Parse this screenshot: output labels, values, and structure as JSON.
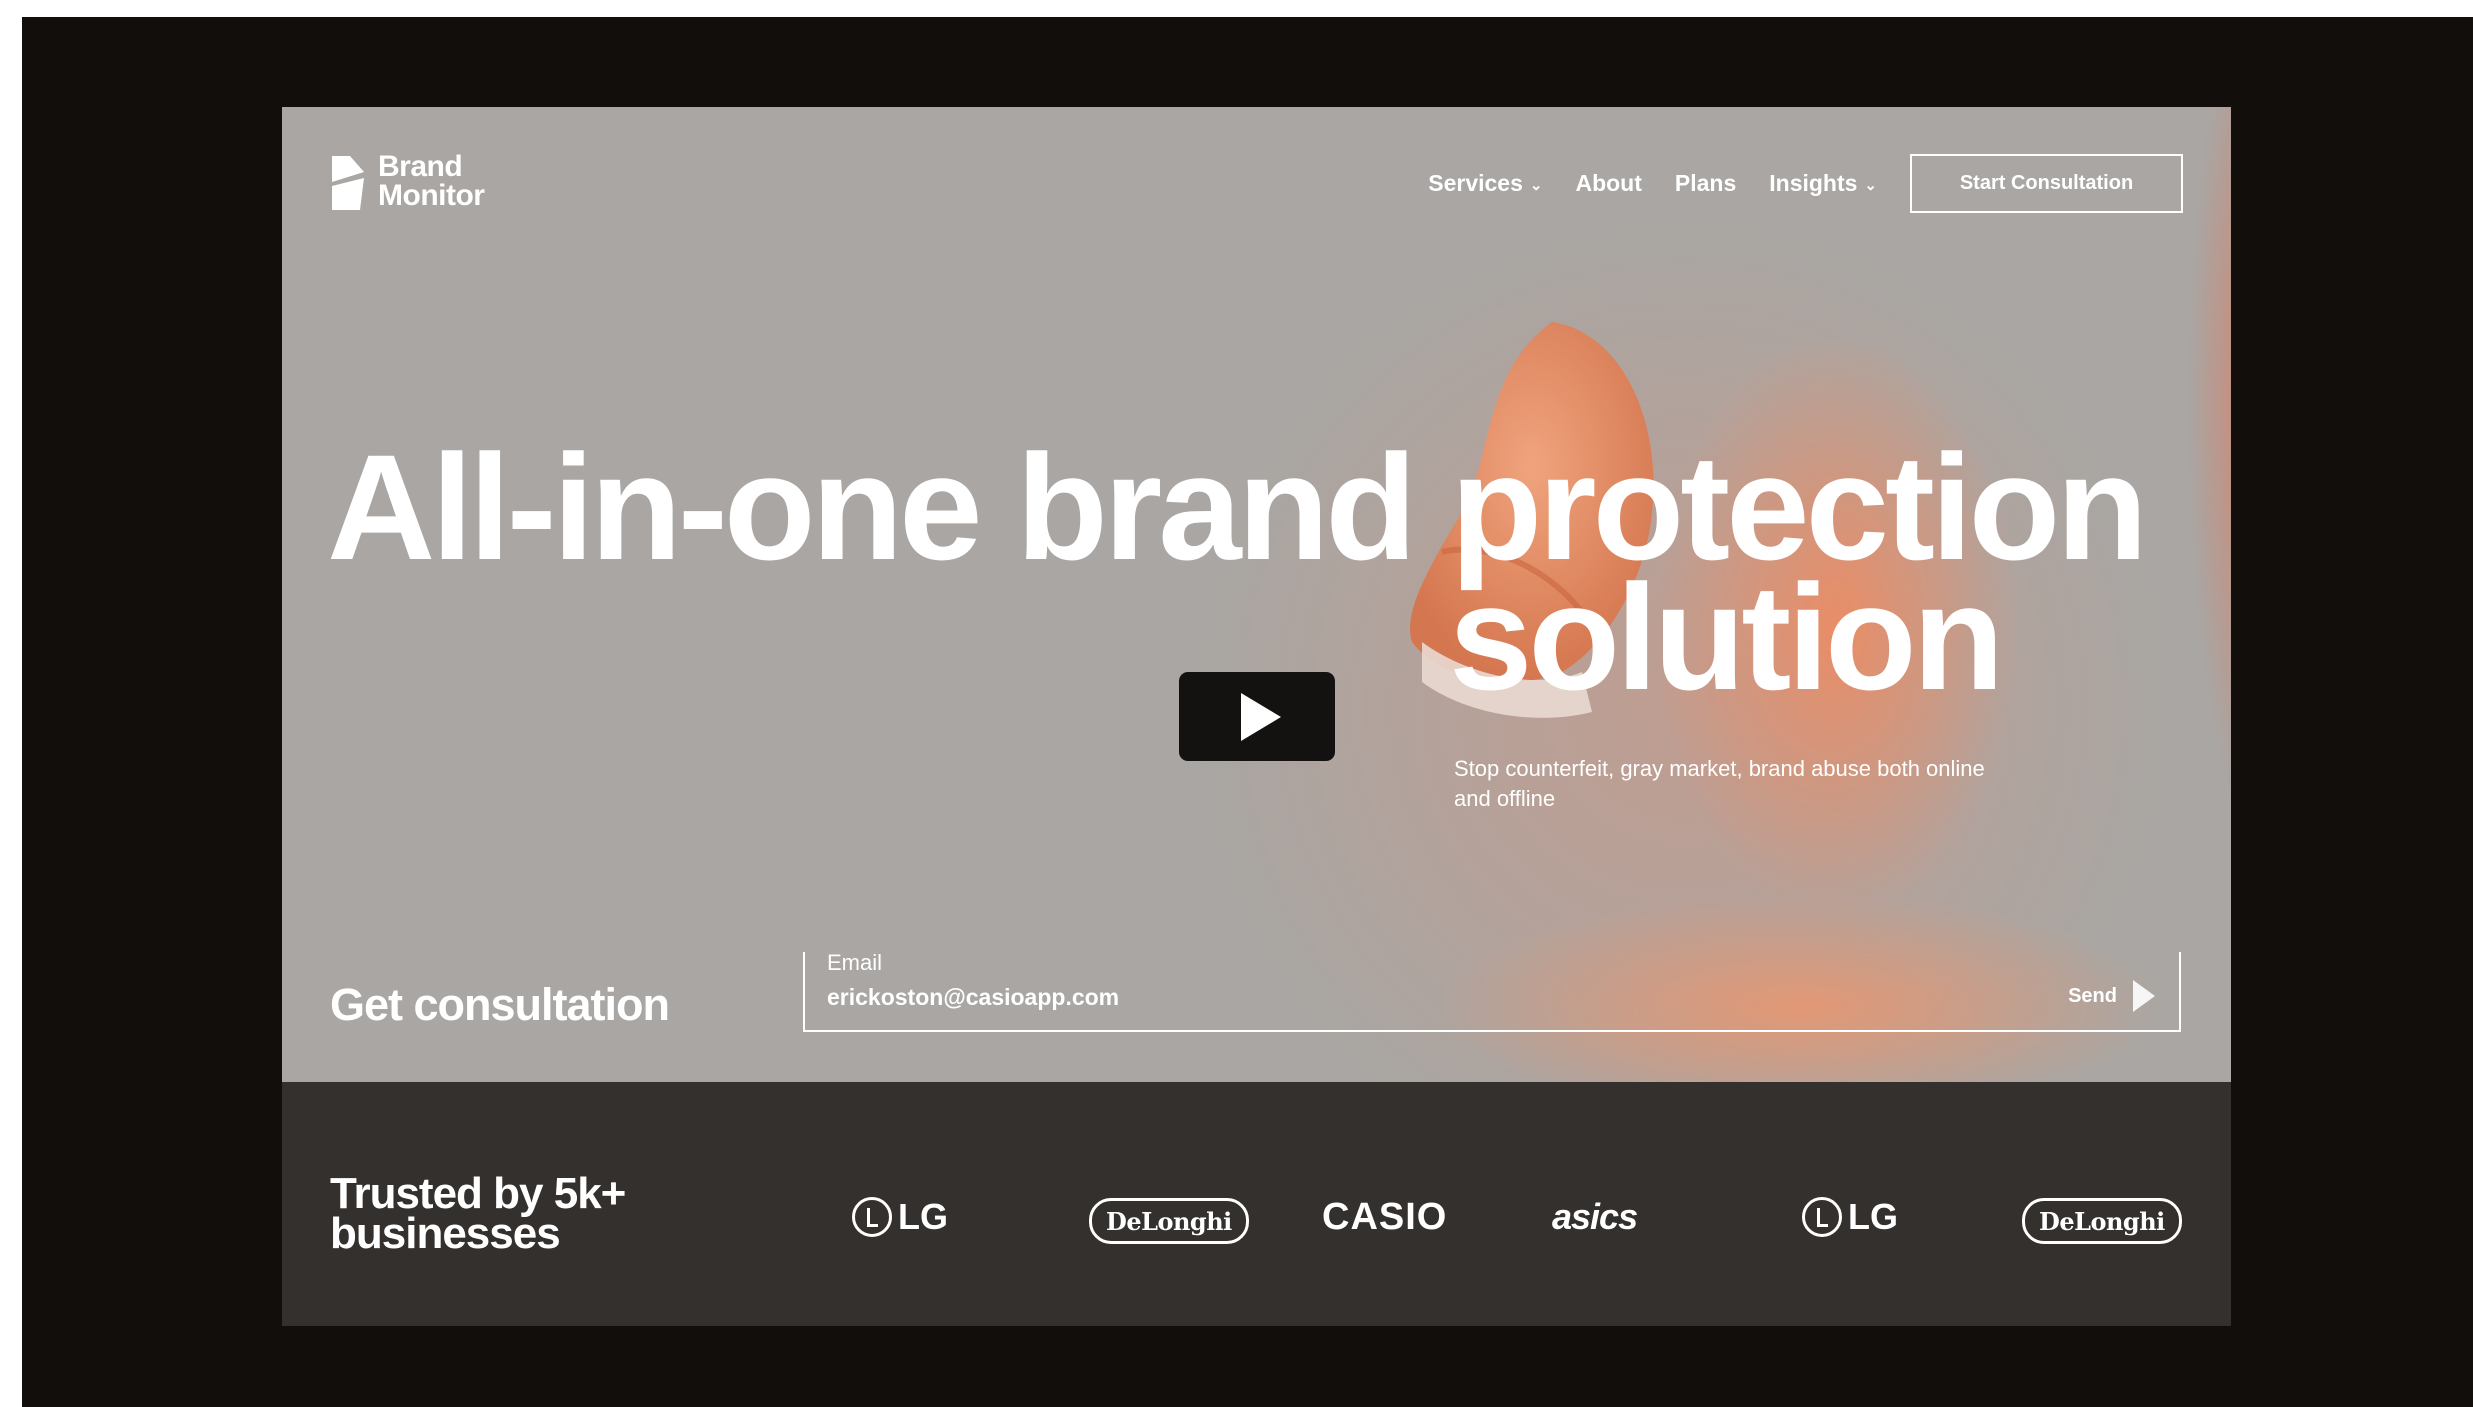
{
  "header": {
    "logo": {
      "line1": "Brand",
      "line2": "Monitor"
    },
    "nav": [
      {
        "label": "Services",
        "dropdown": true
      },
      {
        "label": "About",
        "dropdown": false
      },
      {
        "label": "Plans",
        "dropdown": false
      },
      {
        "label": "Insights",
        "dropdown": true
      }
    ],
    "cta_label": "Start Consultation"
  },
  "hero": {
    "headline_line1": "All-in-one brand protection",
    "headline_line2": "solution",
    "subline": "Stop counterfeit, gray market, brand abuse both online and offline",
    "play_icon": "play-icon"
  },
  "consultation": {
    "title": "Get consultation",
    "email_label": "Email",
    "email_value": "erickoston@casioapp.com",
    "send_label": "Send"
  },
  "trusted": {
    "title_line1": "Trusted by 5k+",
    "title_line2": "businesses",
    "logos": [
      "LG",
      "DeLonghi",
      "CASIO",
      "asics",
      "LG",
      "DeLonghi"
    ]
  },
  "colors": {
    "page_frame": "#120e0b",
    "hero_bg": "#a9a6a3",
    "accent_orange": "#ec8c64",
    "trusted_bg": "#33302d",
    "text": "#ffffff"
  }
}
